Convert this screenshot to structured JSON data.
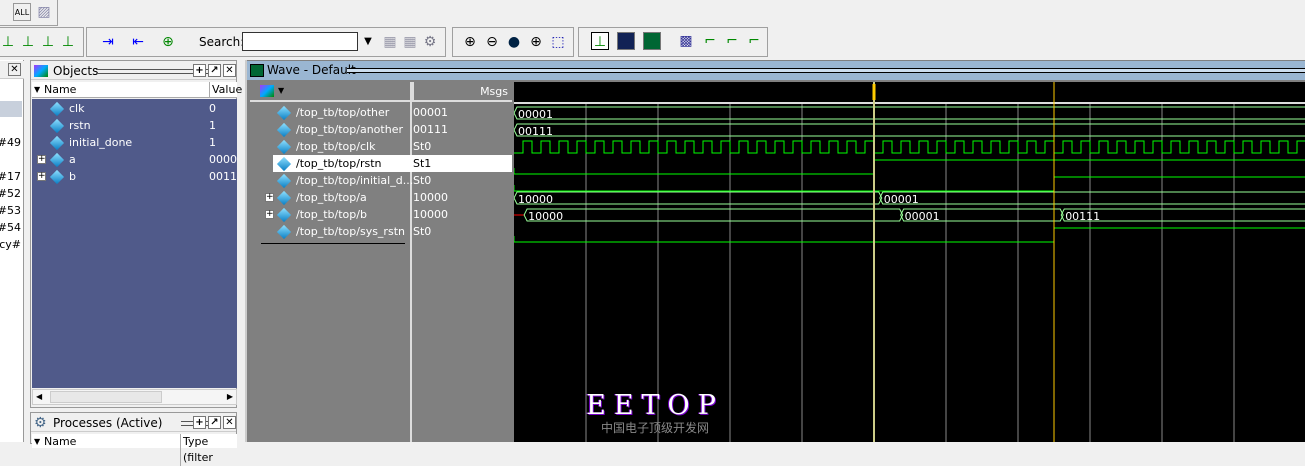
{
  "toolbar": {
    "search_label": "Search:",
    "search_value": ""
  },
  "left_panel": {
    "items": [
      "#49",
      "#17",
      "#52",
      "#53",
      "#54",
      "cy#"
    ]
  },
  "objects": {
    "title": "Objects",
    "col_name": "Name",
    "col_value": "Value",
    "items": [
      {
        "name": "clk",
        "value": "0"
      },
      {
        "name": "rstn",
        "value": "1"
      },
      {
        "name": "initial_done",
        "value": "1"
      },
      {
        "name": "a",
        "value": "0000"
      },
      {
        "name": "b",
        "value": "0011"
      }
    ]
  },
  "processes": {
    "title": "Processes (Active)",
    "col_name": "Name",
    "col_type": "Type (filter"
  },
  "wave": {
    "title": "Wave - Default",
    "msgs_label": "Msgs",
    "signals": [
      {
        "name": "/top_tb/top/other",
        "msg": "00001",
        "kind": "bus",
        "events": [
          [
            0,
            "00001"
          ]
        ]
      },
      {
        "name": "/top_tb/top/another",
        "msg": "00111",
        "kind": "bus",
        "events": [
          [
            0,
            "00111"
          ]
        ]
      },
      {
        "name": "/top_tb/top/clk",
        "msg": "St0",
        "kind": "clock",
        "period": 0.25
      },
      {
        "name": "/top_tb/top/rstn",
        "msg": "St1",
        "kind": "bit",
        "events": [
          [
            0,
            0
          ],
          [
            5.0,
            1
          ]
        ]
      },
      {
        "name": "/top_tb/top/initial_d...",
        "msg": "St0",
        "kind": "bit",
        "events": [
          [
            0,
            0
          ],
          [
            7.5,
            1
          ]
        ]
      },
      {
        "name": "/top_tb/top/a",
        "msg": "10000",
        "kind": "bus",
        "expand": true,
        "events": [
          [
            0,
            "10000"
          ],
          [
            5.08,
            "00001"
          ]
        ]
      },
      {
        "name": "/top_tb/top/b",
        "msg": "10000",
        "kind": "bus",
        "expand": true,
        "events": [
          [
            0.14,
            "10000"
          ],
          [
            5.37,
            "00001"
          ],
          [
            7.6,
            "00111"
          ]
        ]
      },
      {
        "name": "/top_tb/top/sys_rstn",
        "msg": "St0",
        "kind": "bit",
        "events": [
          [
            0,
            0
          ],
          [
            7.5,
            1
          ]
        ]
      }
    ],
    "selected_index": 3,
    "cursors": [
      5.0,
      7.5
    ],
    "grid_count": 11
  },
  "watermark": {
    "title": "EETOP",
    "subtitle": "中国电子顶级开发网"
  }
}
